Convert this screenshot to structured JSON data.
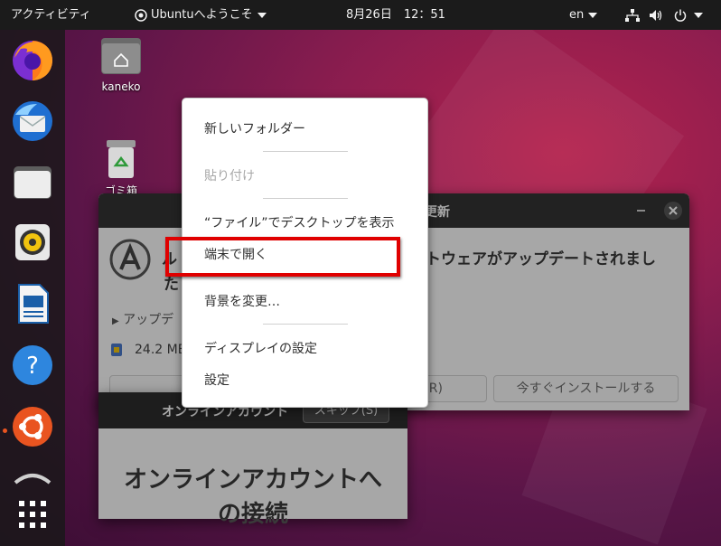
{
  "topbar": {
    "activities": "アクティビティ",
    "app_menu": "Ubuntuへようこそ",
    "clock": "8月26日　12：51",
    "language": "en"
  },
  "dock": {
    "items": [
      {
        "name": "firefox",
        "icon": "firefox-icon"
      },
      {
        "name": "thunderbird",
        "icon": "thunderbird-icon"
      },
      {
        "name": "files",
        "icon": "folder-icon"
      },
      {
        "name": "rhythmbox",
        "icon": "speaker-icon"
      },
      {
        "name": "libreoffice-writer",
        "icon": "document-icon"
      },
      {
        "name": "help",
        "icon": "help-icon"
      },
      {
        "name": "ubuntu-software",
        "icon": "ubuntu-icon"
      },
      {
        "name": "partial",
        "icon": "partial-icon"
      },
      {
        "name": "show-applications",
        "icon": "grid-icon"
      }
    ]
  },
  "desktop": {
    "home_folder_label": "kaneko",
    "trash_label": "ゴミ箱"
  },
  "update_window": {
    "title_visible": "更新",
    "message_visible_line1": "ル",
    "message_visible_line1_right": "トウェア",
    "message_visible_line1_end": "がアップデートされまし",
    "message_visible_line2": "た",
    "details_label": "アップデ",
    "download_size": "24.2 MB",
    "remind_button_suffix": "(R)",
    "install_now_button": "今すぐインストールする"
  },
  "online_accounts": {
    "title": "オンラインアカウント",
    "skip_button": "スキップ(S)",
    "heading_line1": "オンラインアカウントへ",
    "heading_line2": "の接続"
  },
  "context_menu": {
    "items": [
      {
        "label": "新しいフォルダー",
        "enabled": true
      },
      {
        "label": "貼り付け",
        "enabled": false
      },
      {
        "label": "“ファイル”でデスクトップを表示",
        "enabled": true
      },
      {
        "label": "端末で開く",
        "enabled": true,
        "highlighted": true
      },
      {
        "label": "背景を変更…",
        "enabled": true
      },
      {
        "label": "ディスプレイの設定",
        "enabled": true
      },
      {
        "label": "設定",
        "enabled": true
      }
    ]
  },
  "colors": {
    "highlight_box": "#e00000",
    "ubuntu_orange": "#e95420",
    "topbar_bg": "#1b1b1b",
    "wallpaper": "#8c1d4f"
  }
}
